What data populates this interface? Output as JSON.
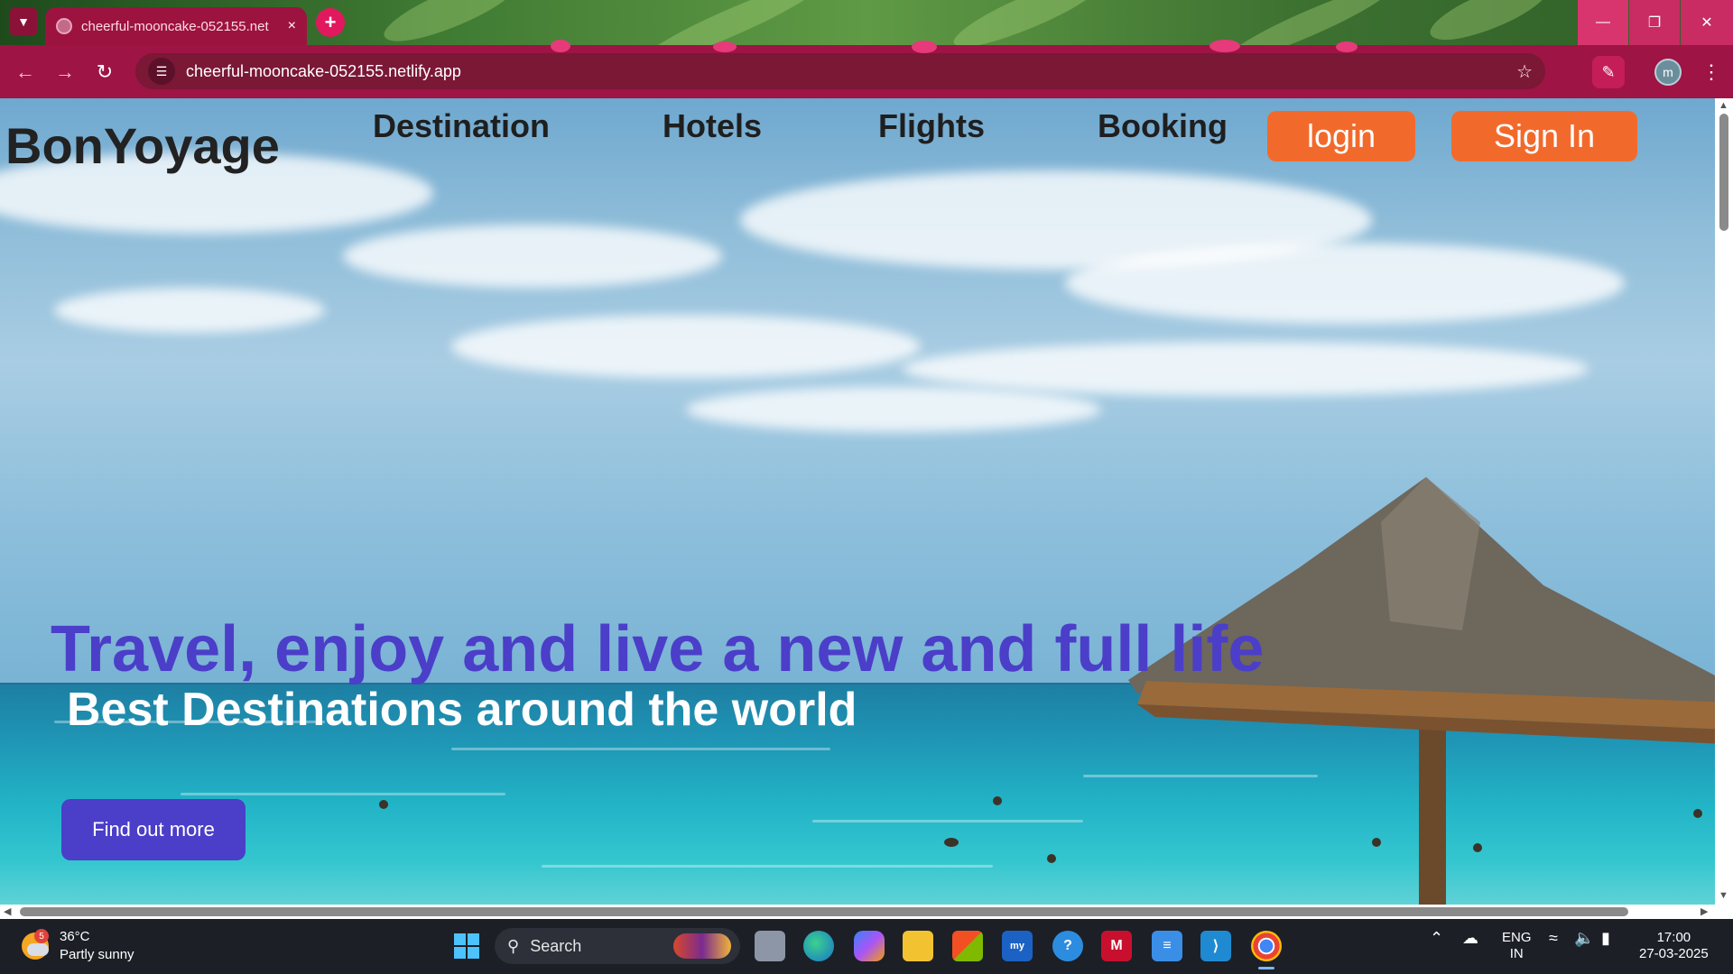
{
  "browser": {
    "tab_title": "cheerful-mooncake-052155.net",
    "tab_close": "×",
    "new_tab": "+",
    "url": "cheerful-mooncake-052155.netlify.app",
    "profile_initial": "m",
    "icons": [
      "tab-search-icon",
      "globe-favicon-icon",
      "back-arrow-icon",
      "forward-arrow-icon",
      "reload-icon",
      "site-info-icon",
      "star-icon",
      "extensions-icon",
      "kebab-menu-icon",
      "minimize-icon",
      "maximize-icon",
      "close-icon"
    ]
  },
  "site": {
    "logo": "BonYoyage",
    "nav": [
      "Destination",
      "Hotels",
      "Flights",
      "Booking"
    ],
    "login_label": "login",
    "signin_label": "Sign In",
    "headline": "Travel, enjoy and live a new and full life",
    "subheadline": "Best Destinations around the world",
    "cta_label": "Find out more",
    "colors": {
      "accent_orange": "#f26a2b",
      "accent_purple": "#4b3ec9",
      "browser_theme": "#9e1444"
    }
  },
  "taskbar": {
    "weather_badge": "5",
    "temperature": "36°C",
    "condition": "Partly sunny",
    "search_label": "Search",
    "lang_top": "ENG",
    "lang_bottom": "IN",
    "time": "17:00",
    "date": "27-03-2025",
    "pinned_apps": [
      "windows-start-icon",
      "task-view-icon",
      "edge-icon",
      "copilot-icon",
      "file-explorer-icon",
      "ms-store-icon",
      "myhp-icon",
      "help-icon",
      "mcafee-icon",
      "notepad-icon",
      "vscode-icon",
      "chrome-icon"
    ]
  }
}
